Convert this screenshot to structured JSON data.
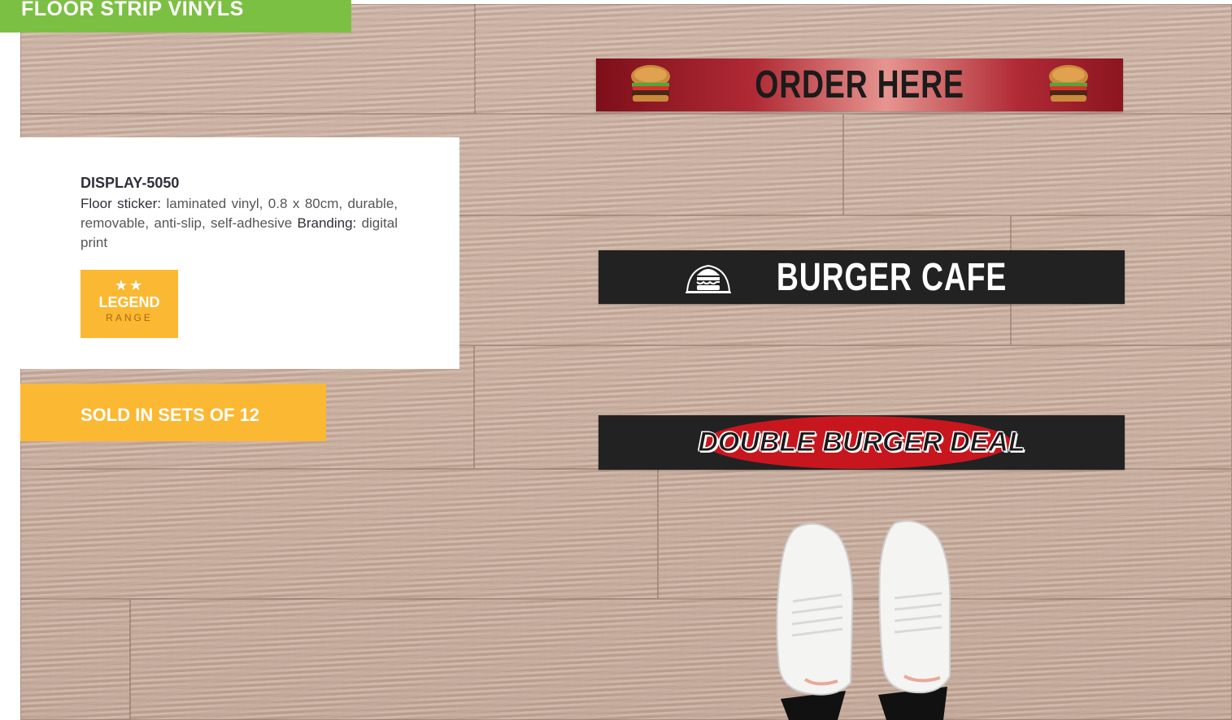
{
  "header": {
    "title": "FLOOR STRIP VINYLS"
  },
  "product": {
    "code": "DISPLAY-5050",
    "floor_label": "Floor sticker:",
    "floor_text": "laminated vinyl, 0.8 x 80cm, durable, removable, anti-slip, self-adhesive",
    "branding_label": "Branding:",
    "branding_text": "digital print"
  },
  "badge": {
    "stars": "★★",
    "name": "LEGEND",
    "range": "RANGE"
  },
  "sold": "SOLD IN SETS OF 12",
  "strips": {
    "order": "ORDER HERE",
    "cafe": "BURGER CAFE",
    "deal": "DOUBLE BURGER DEAL"
  },
  "colors": {
    "green": "#7cc043",
    "yellow": "#fbb833",
    "strip_red": "#b02a35",
    "strip_black": "#222222"
  }
}
